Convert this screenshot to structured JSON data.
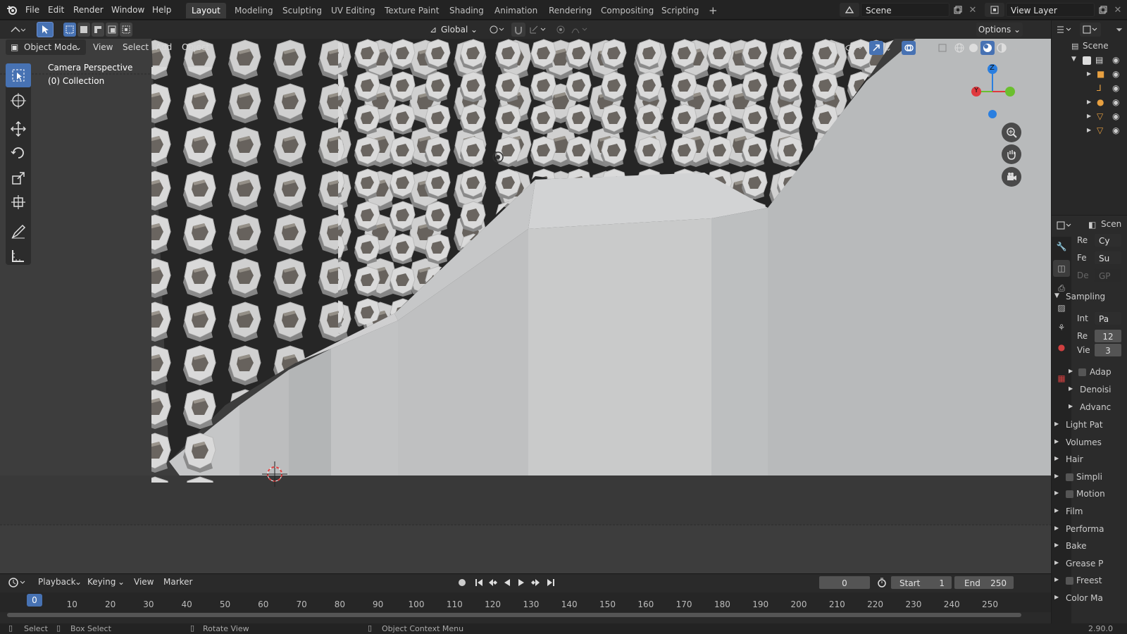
{
  "menu": [
    "File",
    "Edit",
    "Render",
    "Window",
    "Help"
  ],
  "workspaces": [
    "Layout",
    "Modeling",
    "Sculpting",
    "UV Editing",
    "Texture Paint",
    "Shading",
    "Animation",
    "Rendering",
    "Compositing",
    "Scripting"
  ],
  "add_tab_label": "+",
  "scene_field": "Scene",
  "view_layer_field": "View Layer",
  "toolbar": {
    "transform": "Global",
    "options": "Options"
  },
  "header": {
    "mode": "Object Mode",
    "menus": [
      "View",
      "Select",
      "Add",
      "Object"
    ]
  },
  "viewport": {
    "info_line1": "Camera Perspective",
    "info_line2": "(0) Collection",
    "gizmo_z": "Z",
    "gizmo_y": "Y"
  },
  "outliner": {
    "title": "Scene"
  },
  "properties": {
    "header_label": "Scen",
    "rows": [
      {
        "label": "Re",
        "value": "Cy"
      },
      {
        "label": "Fe",
        "value": "Su"
      },
      {
        "label": "De",
        "value": "GP"
      }
    ],
    "sampling_panel": "Sampling",
    "sampling_rows": [
      {
        "label": "Int",
        "value": "Pa"
      },
      {
        "label": "Re",
        "value": "12"
      },
      {
        "label": "Vie",
        "value": "3"
      }
    ],
    "subpanels": [
      "Adap",
      "Denoisi",
      "Advanc"
    ],
    "panels": [
      "Light Pat",
      "Volumes",
      "Hair",
      "Simpli",
      "Motion",
      "Film",
      "Performa",
      "Bake",
      "Grease P",
      "Freest",
      "Color Ma"
    ],
    "panel_checkbox": [
      false,
      false,
      false,
      true,
      true,
      false,
      false,
      false,
      false,
      true,
      false
    ]
  },
  "timeline": {
    "menus": [
      "Playback",
      "Keying",
      "View",
      "Marker"
    ],
    "current_frame": "0",
    "start_label": "Start",
    "start_value": "1",
    "end_label": "End",
    "end_value": "250",
    "ticks": [
      "0",
      "10",
      "20",
      "30",
      "40",
      "50",
      "60",
      "70",
      "80",
      "90",
      "100",
      "110",
      "120",
      "130",
      "140",
      "150",
      "160",
      "170",
      "180",
      "190",
      "200",
      "210",
      "220",
      "230",
      "240",
      "250"
    ]
  },
  "status": {
    "select": "Select",
    "box_select": "Box Select",
    "rotate": "Rotate View",
    "context": "Object Context Menu",
    "version": "2.90.0"
  },
  "colors": {
    "accent": "#4772b3",
    "x_axis": "#e0393e",
    "y_axis": "#6bbf2e",
    "z_axis": "#2a7fe0"
  }
}
